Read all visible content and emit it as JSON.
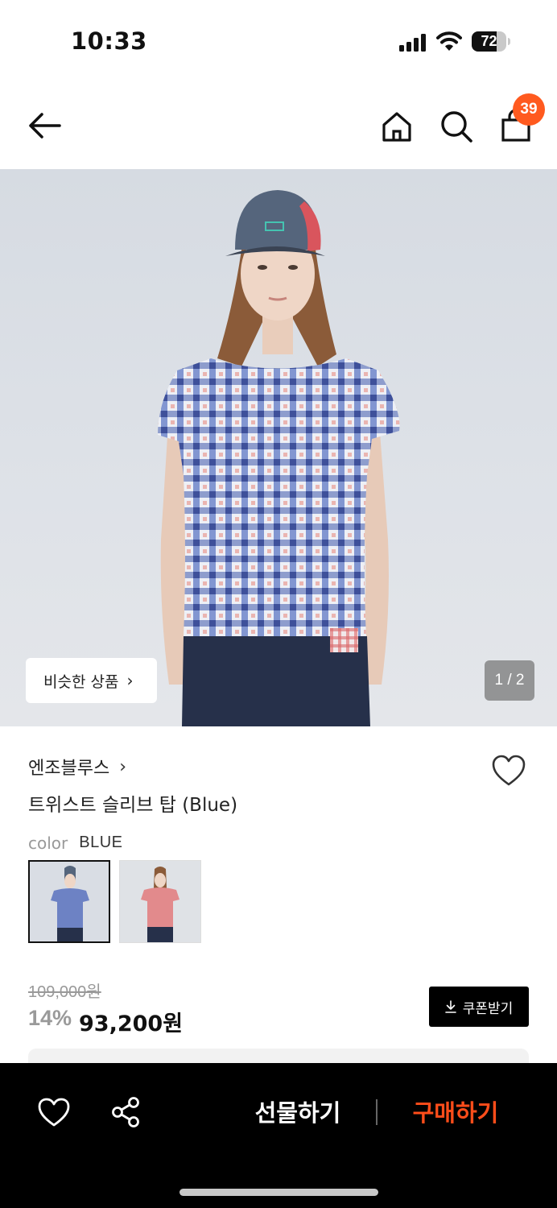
{
  "status_bar": {
    "time": "10:33",
    "battery_percent": "72",
    "battery_level": 0.72
  },
  "nav": {
    "cart_count": "39",
    "icons": [
      "back-arrow-icon",
      "home-icon",
      "search-icon",
      "shopping-bag-icon"
    ]
  },
  "hero": {
    "similar_label": "비슷한 상품",
    "similar_chevron": "›",
    "pager": "1 / 2"
  },
  "product": {
    "brand": "엔조블루스",
    "brand_chevron": "›",
    "name": "트위스트 슬리브 탑 (Blue)",
    "color_label": "color",
    "color_value": "BLUE",
    "swatches": [
      {
        "color": "blue-check",
        "selected": true
      },
      {
        "color": "red-check",
        "selected": false
      }
    ],
    "original_price": "109,000원",
    "discount": "14%",
    "price": "93,200원",
    "coupon_label": "쿠폰받기"
  },
  "bottom_bar": {
    "gift_label": "선물하기",
    "buy_label": "구매하기"
  },
  "colors": {
    "accent": "#ff5a1f",
    "buy": "#ff4d1a",
    "bar": "#000000"
  }
}
